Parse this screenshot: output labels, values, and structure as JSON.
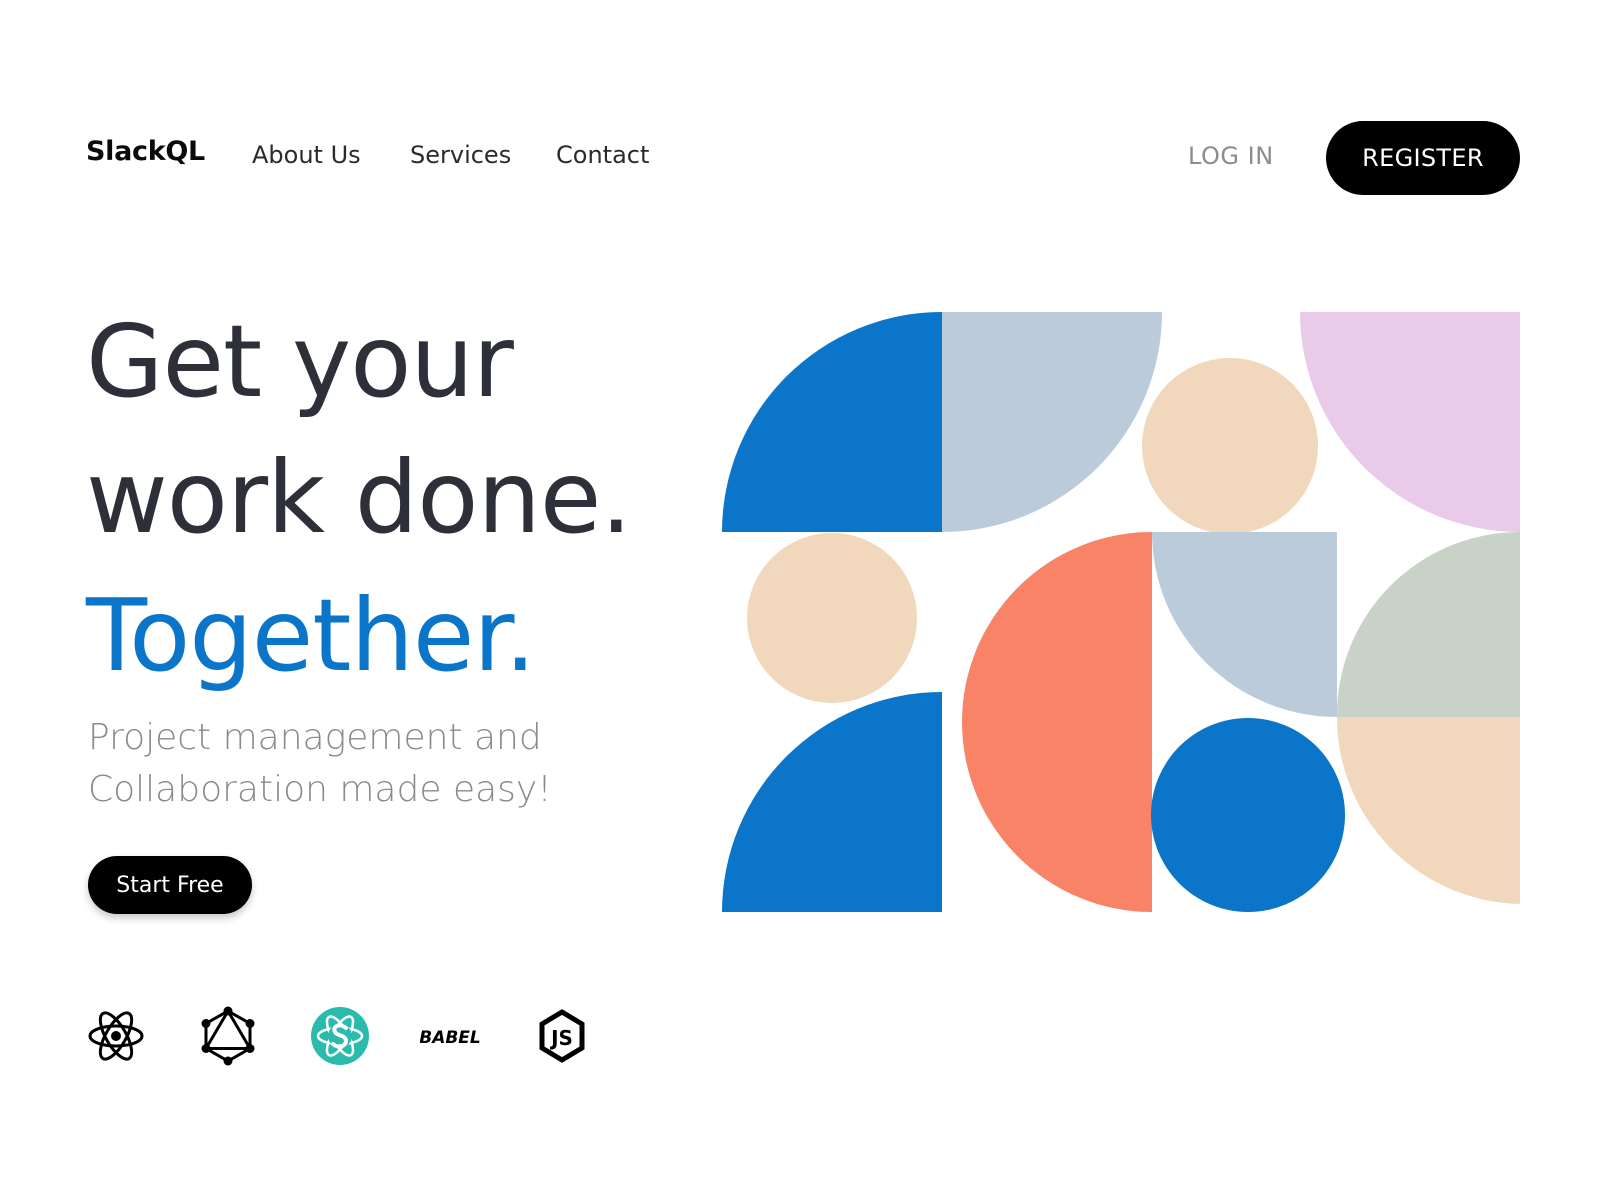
{
  "nav": {
    "brand": "SlackQL",
    "links": [
      "About Us",
      "Services",
      "Contact"
    ],
    "login_label": "LOG IN",
    "register_label": "REGISTER"
  },
  "hero": {
    "line1": "Get your",
    "line2": "work done.",
    "line3": "Together.",
    "subtitle_line1": "Project management and",
    "subtitle_line2": "Collaboration made easy!",
    "cta_label": "Start Free"
  },
  "tech_icons": {
    "react": "react-icon",
    "graphql": "graphql-icon",
    "styled": "styled-icon",
    "babel": "BABEL",
    "node": "JS"
  },
  "colors": {
    "blue": "#0a75c9",
    "gray_blue": "#bccbd9",
    "peach": "#f1d7bb",
    "lilac": "#e9cbe9",
    "coral": "#f88367",
    "sage": "#c8d2c6",
    "text_dark": "#2d3038",
    "text_muted": "#8a8a8a",
    "button_black": "#000000",
    "teal": "#2bbbad"
  }
}
